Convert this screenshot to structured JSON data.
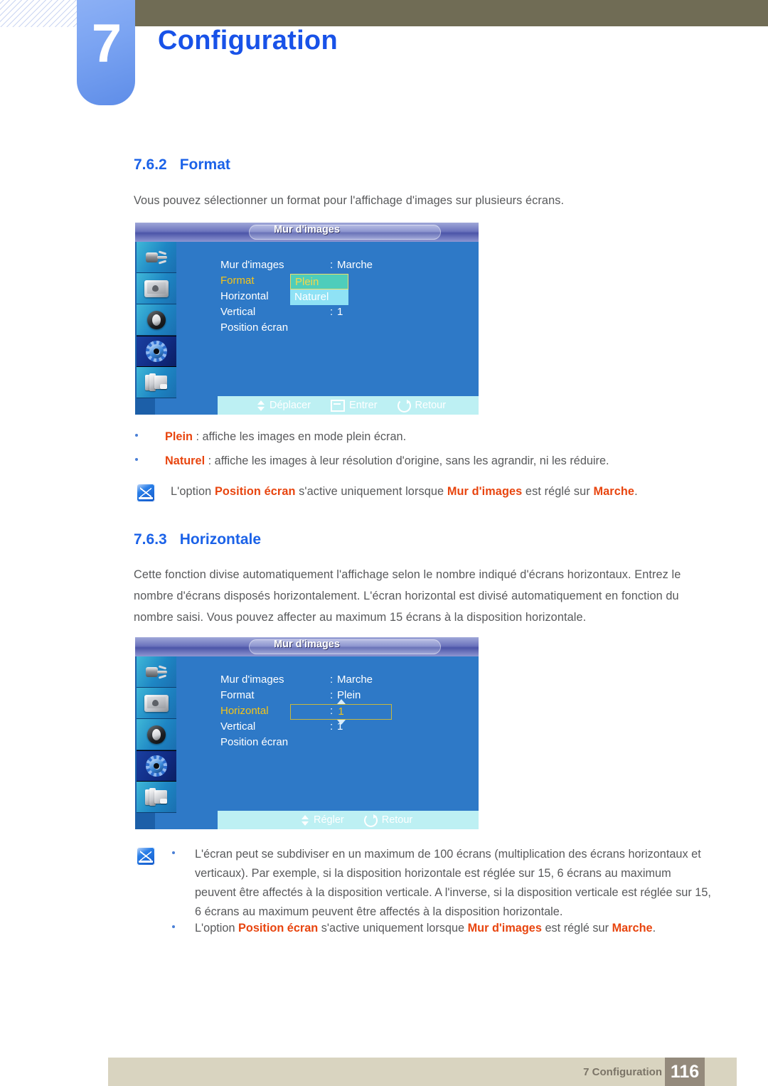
{
  "header": {
    "chapter_number": "7",
    "chapter_title": "Configuration"
  },
  "sections": [
    {
      "number": "7.6.2",
      "title": "Format",
      "intro": "Vous pouvez sélectionner un format pour l'affichage d'images sur plusieurs écrans."
    },
    {
      "number": "7.6.3",
      "title": "Horizontale",
      "intro": "Cette fonction divise automatiquement l'affichage selon le nombre indiqué d'écrans horizontaux. Entrez le nombre d'écrans disposés horizontalement. L'écran horizontal est divisé automatiquement en fonction du nombre saisi. Vous pouvez affecter au maximum 15 écrans à la disposition horizontale."
    }
  ],
  "osd1": {
    "title": "Mur d'images",
    "rows": [
      {
        "label": "Mur d'images",
        "colon": ":",
        "value": "Marche"
      },
      {
        "label": "Format",
        "colon": ":",
        "value": ""
      },
      {
        "label": "Horizontal",
        "colon": ":",
        "value": ""
      },
      {
        "label": "Vertical",
        "colon": ":",
        "value": "1"
      },
      {
        "label": "Position écran",
        "colon": "",
        "value": ""
      }
    ],
    "dropdown": {
      "selected": "Plein",
      "other": "Naturel"
    },
    "footer": [
      {
        "icon": "up-down-arrow-icon",
        "label": "Déplacer"
      },
      {
        "icon": "enter-key-icon",
        "label": "Entrer"
      },
      {
        "icon": "return-arrow-icon",
        "label": "Retour"
      }
    ],
    "sidebar_icons": [
      "plug-icon",
      "picture-icon",
      "speaker-icon",
      "gear-icon",
      "system-icon"
    ],
    "selected_icon_index": 3
  },
  "osd2": {
    "title": "Mur d'images",
    "rows": [
      {
        "label": "Mur d'images",
        "colon": ":",
        "value": "Marche"
      },
      {
        "label": "Format",
        "colon": ":",
        "value": "Plein"
      },
      {
        "label": "Horizontal",
        "colon": ":",
        "value": ""
      },
      {
        "label": "Vertical",
        "colon": ":",
        "value": "1"
      },
      {
        "label": "Position écran",
        "colon": "",
        "value": ""
      }
    ],
    "spinner": {
      "value": "1"
    },
    "footer": [
      {
        "icon": "up-down-arrow-icon",
        "label": "Régler"
      },
      {
        "icon": "return-arrow-icon",
        "label": "Retour"
      }
    ],
    "sidebar_icons": [
      "plug-icon",
      "picture-icon",
      "speaker-icon",
      "gear-icon",
      "system-icon"
    ],
    "selected_icon_index": 3
  },
  "bullets_format": [
    {
      "term": "Plein",
      "rest": " : affiche les images en mode plein écran."
    },
    {
      "term": "Naturel",
      "rest": " : affiche les images à leur résolution d'origine, sans les agrandir, ni les réduire."
    }
  ],
  "note1": {
    "pre": "L'option ",
    "kw1": "Position écran",
    "mid1": " s'active uniquement lorsque ",
    "kw2": "Mur d'images",
    "mid2": " est réglé sur ",
    "kw3": "Marche",
    "end": "."
  },
  "note2": {
    "bullet1": "L'écran peut se subdiviser en un maximum de 100 écrans (multiplication des écrans horizontaux et verticaux). Par exemple, si la disposition horizontale est réglée sur 15, 6 écrans au maximum peuvent être affectés à la disposition verticale. A l'inverse, si la disposition verticale est réglée sur 15, 6 écrans au maximum peuvent être affectés à la disposition horizontale.",
    "bullet2": {
      "pre": "L'option ",
      "kw1": "Position écran",
      "mid1": " s'active uniquement lorsque ",
      "kw2": "Mur d'images",
      "mid2": " est réglé sur ",
      "kw3": "Marche",
      "end": "."
    }
  },
  "page_footer": {
    "label": "7 Configuration",
    "number": "116"
  },
  "colors": {
    "heading_blue": "#1b62e8",
    "keyword_orange": "#e8450f",
    "body_gray": "#58595b",
    "olive": "#706c55",
    "footer_beige": "#d9d4c0",
    "footer_brown": "#948a7c",
    "osd_blue": "#2e79c7",
    "osd_highlight_teal": "#4ecdbb",
    "osd_highlight_cyan": "#8fe2f5",
    "osd_yellow": "#f5c518"
  }
}
